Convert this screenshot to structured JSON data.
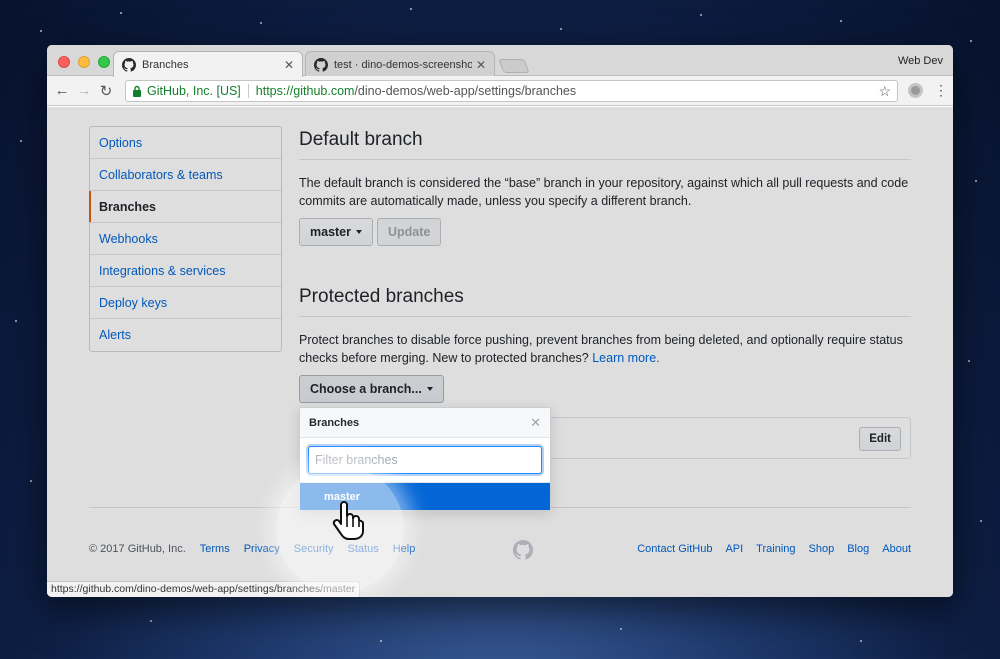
{
  "window": {
    "profile": "Web Dev"
  },
  "tabs": [
    {
      "title": "Branches",
      "active": true,
      "icon": "github-icon"
    },
    {
      "title": "test · dino-demos-screenshot",
      "active": false,
      "icon": "github-icon"
    }
  ],
  "toolbar": {
    "ev_label": "GitHub, Inc. [US]",
    "url_host": "https://github.com",
    "url_path": "/dino-demos/web-app/settings/branches"
  },
  "sidebar": {
    "items": [
      {
        "label": "Options"
      },
      {
        "label": "Collaborators & teams"
      },
      {
        "label": "Branches",
        "selected": true
      },
      {
        "label": "Webhooks"
      },
      {
        "label": "Integrations & services"
      },
      {
        "label": "Deploy keys"
      },
      {
        "label": "Alerts"
      }
    ]
  },
  "default_branch": {
    "heading": "Default branch",
    "description": "The default branch is considered the “base” branch in your repository, against which all pull requests and code commits are automatically made, unless you specify a different branch.",
    "branch_button": "master",
    "update_button": "Update"
  },
  "protected_branches": {
    "heading": "Protected branches",
    "description": "Protect branches to disable force pushing, prevent branches from being deleted, and optionally require status checks before merging. New to protected branches?",
    "learn_more": "Learn more.",
    "choose_button": "Choose a branch...",
    "edit_button": "Edit"
  },
  "dropdown": {
    "header": "Branches",
    "filter_placeholder": "Filter branches",
    "options": [
      "master"
    ]
  },
  "footer": {
    "copyright": "© 2017 GitHub, Inc.",
    "left_links": [
      "Terms",
      "Privacy",
      "Security",
      "Status",
      "Help"
    ],
    "right_links": [
      "Contact GitHub",
      "API",
      "Training",
      "Shop",
      "Blog",
      "About"
    ]
  },
  "status_bar": {
    "url": "https://github.com/dino-demos/web-app/settings/branches/master"
  },
  "colors": {
    "link": "#0366d6",
    "selected_accent": "#e36209",
    "option_highlight": "#0366d6"
  }
}
